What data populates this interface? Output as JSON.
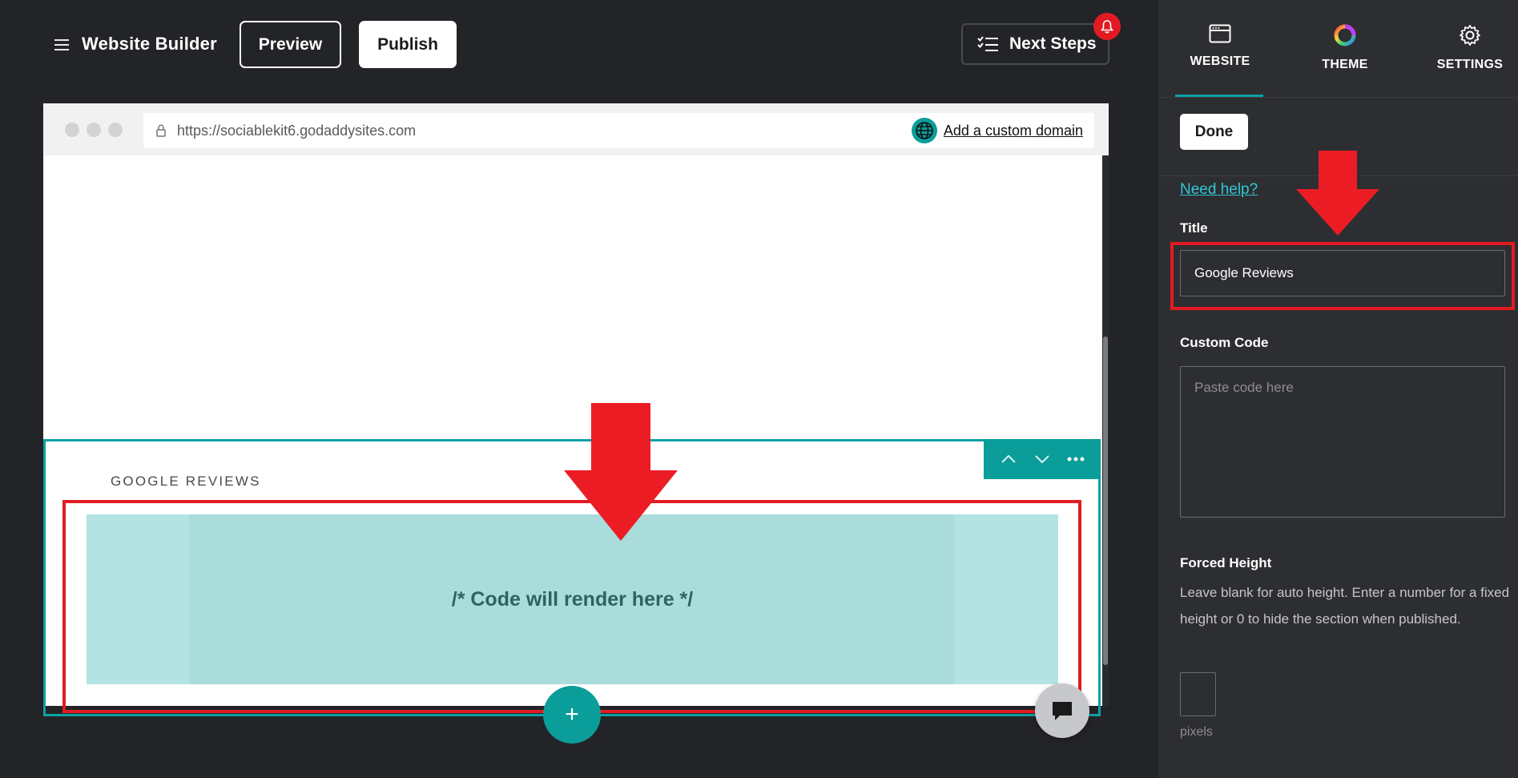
{
  "topbar": {
    "menu_label": "Website Builder",
    "preview_label": "Preview",
    "publish_label": "Publish",
    "next_steps_label": "Next Steps"
  },
  "browser": {
    "url": "https://sociablekit6.godaddysites.com",
    "custom_domain_label": "Add a custom domain"
  },
  "section": {
    "title": "GOOGLE REVIEWS",
    "code_placeholder": "/* Code will render here */",
    "add_label": "+"
  },
  "panel": {
    "tabs": [
      {
        "label": "WEBSITE",
        "icon": "browser-window-icon",
        "active": true
      },
      {
        "label": "THEME",
        "icon": "color-wheel-icon",
        "active": false
      },
      {
        "label": "SETTINGS",
        "icon": "gear-icon",
        "active": false
      }
    ],
    "done_label": "Done",
    "need_help_label": "Need help?",
    "title_label": "Title",
    "title_value": "Google Reviews",
    "custom_code_label": "Custom Code",
    "custom_code_placeholder": "Paste code here",
    "forced_height_label": "Forced Height",
    "forced_height_help": "Leave blank for auto height. Enter a number for a fixed height or 0 to hide the section when published.",
    "pixels_label": "pixels"
  },
  "colors": {
    "background": "#232427",
    "panel": "#2d2e31",
    "accent": "#0a9d9a",
    "annotation": "#e21b23",
    "link": "#31c6d4"
  }
}
